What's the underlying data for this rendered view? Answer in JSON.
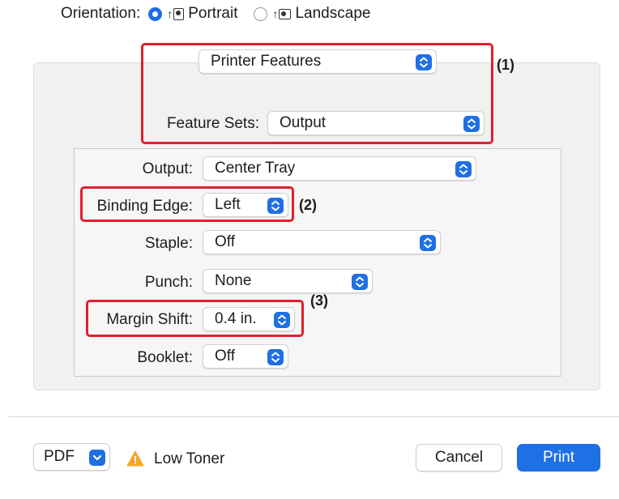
{
  "orientation": {
    "label": "Orientation:",
    "portrait_label": "Portrait",
    "landscape_label": "Landscape",
    "selected": "Portrait"
  },
  "preset_menu": {
    "value": "Printer Features"
  },
  "feature_sets": {
    "label": "Feature Sets:",
    "value": "Output"
  },
  "fields": {
    "output": {
      "label": "Output:",
      "value": "Center Tray"
    },
    "binding_edge": {
      "label": "Binding Edge:",
      "value": "Left"
    },
    "staple": {
      "label": "Staple:",
      "value": "Off"
    },
    "punch": {
      "label": "Punch:",
      "value": "None"
    },
    "margin_shift": {
      "label": "Margin Shift:",
      "value": "0.4 in."
    },
    "booklet": {
      "label": "Booklet:",
      "value": "Off"
    }
  },
  "callouts": {
    "one": "(1)",
    "two": "(2)",
    "three": "(3)"
  },
  "footer": {
    "pdf_label": "PDF",
    "warning_text": "Low Toner",
    "cancel_label": "Cancel",
    "print_label": "Print"
  },
  "colors": {
    "accent": "#1f6fe5",
    "highlight": "#e0202e",
    "warning": "#f5a623"
  },
  "icons": {
    "portrait": "portrait-orientation-icon",
    "landscape": "landscape-orientation-icon",
    "popup": "chevron-up-down-icon",
    "pdf": "chevron-down-icon",
    "warning": "warning-triangle-icon"
  }
}
